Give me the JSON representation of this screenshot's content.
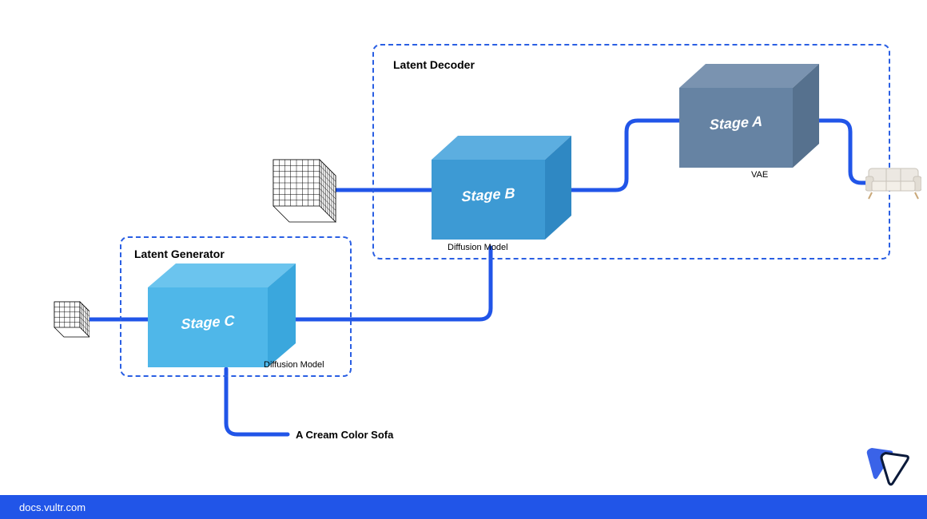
{
  "generator": {
    "title": "Latent Generator",
    "stage_label": "Stage C",
    "sub": "Diffusion Model"
  },
  "decoder": {
    "title": "Latent Decoder",
    "stage_b_label": "Stage B",
    "stage_b_sub": "Diffusion Model",
    "stage_a_label": "Stage A",
    "stage_a_sub": "VAE"
  },
  "prompt_text": "A Cream Color Sofa",
  "footer": "docs.vultr.com",
  "colors": {
    "stage_c_top": "#6bc4ee",
    "stage_c_front": "#4fb7e9",
    "stage_c_side": "#3aa7dd",
    "stage_b_top": "#5caee0",
    "stage_b_front": "#3d9ad4",
    "stage_b_side": "#2f88c3",
    "stage_a_top": "#7a93b0",
    "stage_a_front": "#6683a3",
    "stage_a_side": "#56718e",
    "line": "#2155e8"
  },
  "icons": {
    "small_latent": "grid-cube-small",
    "large_latent": "grid-cube-large",
    "output": "sofa",
    "logo": "vultr-logo"
  }
}
